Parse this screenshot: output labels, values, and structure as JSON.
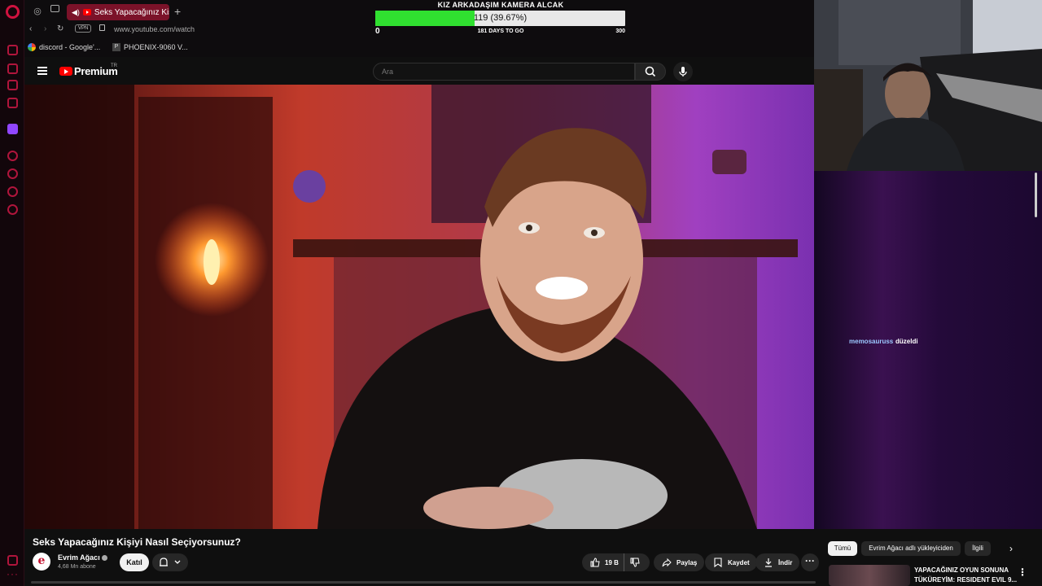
{
  "browser": {
    "active_tab": {
      "title": "Seks Yapacağınız Kişiyi Nasıl Seçiyorsunuz?",
      "icon": "youtube-icon",
      "audio_icon": "speaker-icon"
    },
    "new_tab_label": "+",
    "vpn_label": "VPN",
    "url": "www.youtube.com/watch",
    "bookmarks": [
      {
        "label": "discord - Google'...",
        "icon": "google-icon"
      },
      {
        "label": "PHOENIX-9060 V...",
        "icon": "page-icon"
      }
    ]
  },
  "goal": {
    "title": "KIZ ARKADAŞIM KAMERA ALCAK",
    "progress_text": "119 (39.67%)",
    "progress_fraction": 0.3967,
    "min": "0",
    "max": "300",
    "days_left": "181 DAYS TO GO",
    "fill_color": "#30e030"
  },
  "youtube": {
    "logo_text": "Premium",
    "region": "TR",
    "search_placeholder": "Ara",
    "video": {
      "title": "Seks Yapacağınız Kişiyi Nasıl Seçiyorsunuz?",
      "channel": "Evrim Ağacı",
      "subscribers": "4,68 Mn abone",
      "join_label": "Katıl",
      "like_count": "19 B",
      "share_label": "Paylaş",
      "save_label": "Kaydet",
      "download_label": "İndir"
    },
    "chips": [
      "Tümü",
      "Evrim Ağacı adlı yükleyiciden",
      "İlgili"
    ],
    "recommended": {
      "title": "YAPACAĞINIZ OYUN SONUNA TÜKÜREYİM: RESIDENT EVIL 9..."
    }
  },
  "chat": {
    "messages": [
      {
        "user": "memosauruss",
        "text": "düzeldi"
      }
    ],
    "user_color": "#9cc8ff"
  }
}
